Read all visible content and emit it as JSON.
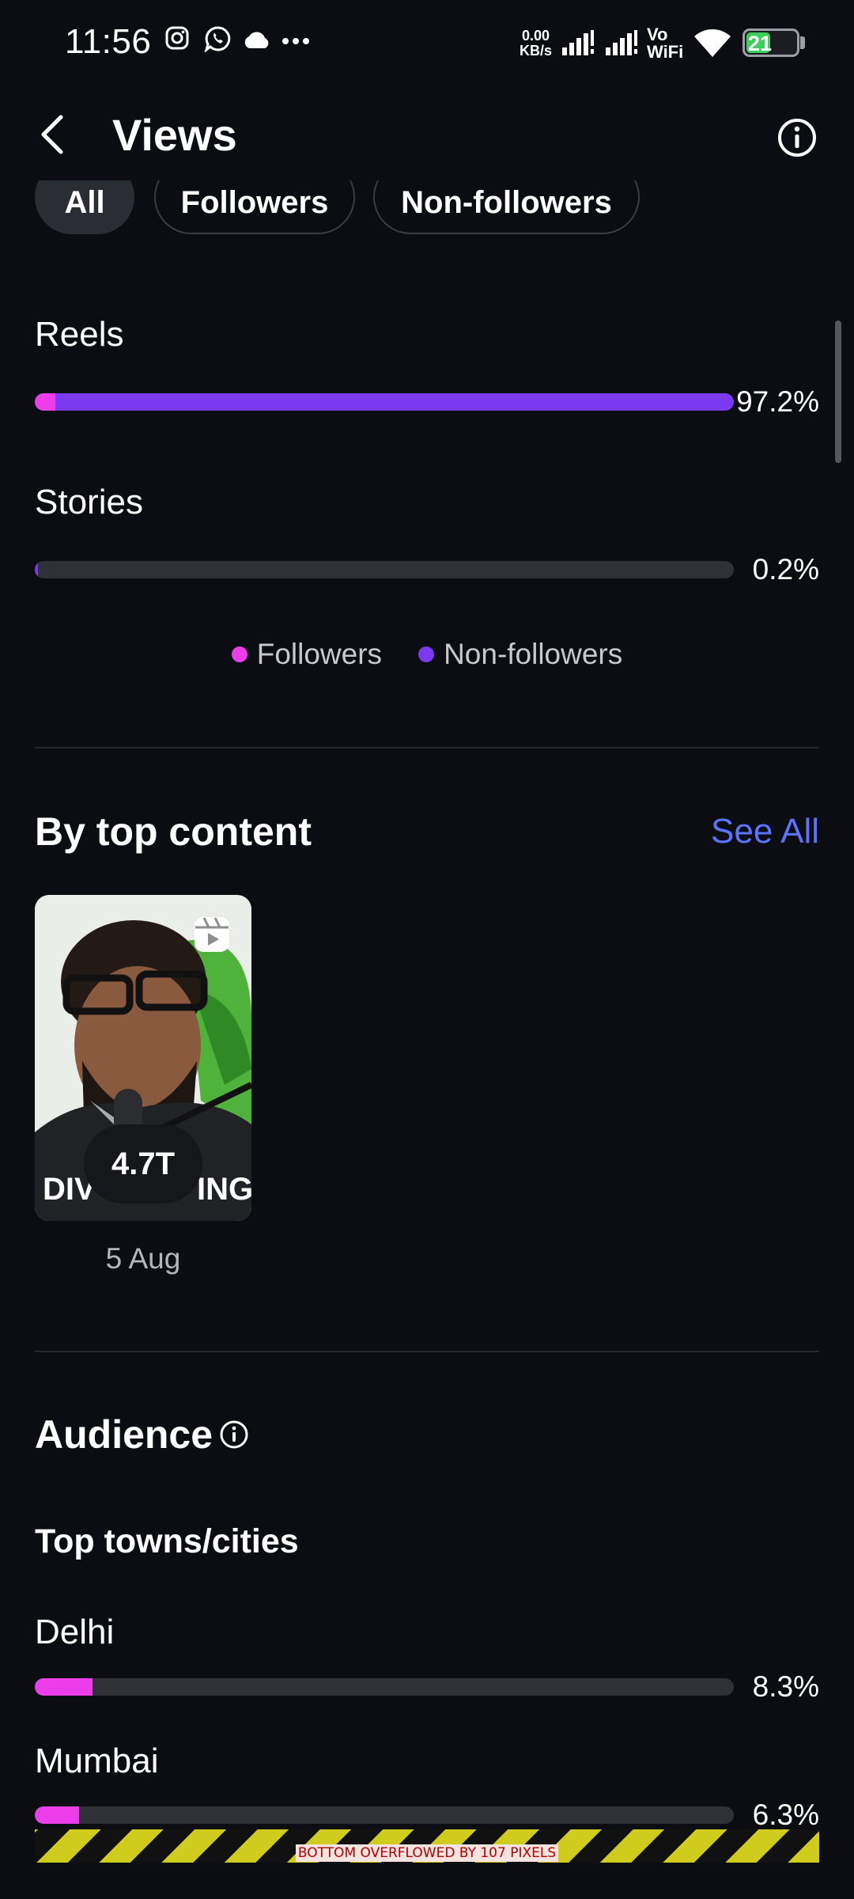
{
  "status_bar": {
    "time": "11:56",
    "net_speed_value": "0.00",
    "net_speed_unit": "KB/s",
    "vowifi_top": "Vo",
    "vowifi_bottom": "WiFi",
    "battery_level": "21"
  },
  "header": {
    "title": "Views"
  },
  "filters": [
    {
      "label": "All",
      "active": true
    },
    {
      "label": "Followers",
      "active": false
    },
    {
      "label": "Non-followers",
      "active": false
    }
  ],
  "content_types": [
    {
      "label": "Reels",
      "percent_text": "97.2%",
      "followers_fraction": 0.029,
      "non_followers_fraction": 0.971
    },
    {
      "label": "Stories",
      "percent_text": "0.2%",
      "followers_fraction": 0.0,
      "non_followers_fraction": 0.004
    }
  ],
  "legend": [
    {
      "label": "Followers",
      "color": "#ec3dea"
    },
    {
      "label": "Non-followers",
      "color": "#7c3af0"
    }
  ],
  "top_content": {
    "title": "By top content",
    "see_all": "See All",
    "items": [
      {
        "views": "4.7T",
        "date": "5 Aug",
        "type_icon": "reel-icon"
      }
    ]
  },
  "audience": {
    "title": "Audience",
    "subtitle": "Top towns/cities",
    "cities": [
      {
        "name": "Delhi",
        "percent_text": "8.3%",
        "fraction": 0.083
      },
      {
        "name": "Mumbai",
        "percent_text": "6.3%",
        "fraction": 0.063
      }
    ]
  },
  "debug_overlay": {
    "text": "BOTTOM OVERFLOWED BY 107 PIXELS"
  },
  "colors": {
    "accent_link": "#5b73ff",
    "followers": "#ec3dea",
    "non_followers": "#7c3af0",
    "background": "#0b0d12"
  }
}
